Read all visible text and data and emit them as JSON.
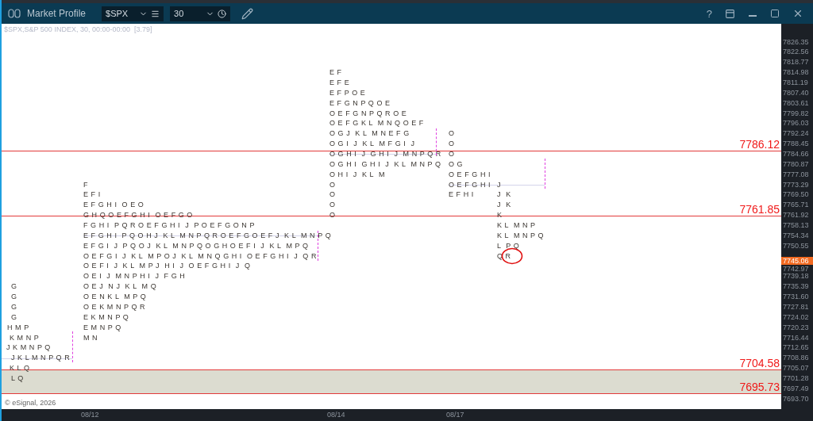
{
  "window": {
    "title": "Market Profile",
    "help": "?"
  },
  "toolbar": {
    "symbol": "$SPX",
    "interval": "30"
  },
  "chart": {
    "legend": "$SPX,S&P 500 INDEX, 30, 00:00-00:00  [3.79]",
    "copyright": "© eSignal, 2026",
    "profiles": [
      {
        "rows": [
          "G",
          "G",
          "G",
          "G",
          "H M P",
          "K M N P",
          "J K M N P Q",
          "J K L M N P Q R",
          "K L Q",
          "L Q"
        ]
      },
      {
        "rows": [
          "F",
          "E F I",
          "E F G H I  O E O",
          "G H Q O E F G H I  O E F G O",
          "F G H I  P Q R O E F G H I  J  P O E F G O N P",
          "E F G H I  P Q O H J  K L  M N P Q R O E F G O E F J  K L  M N P Q",
          "E F G I  J  P Q O J  K L  M N P Q O G H O E F I  J  K L  M P Q",
          "O E F G I  J  K L  M P O J  K L  M N Q G H I  O E F G H I  J  Q R",
          "O E F I  J  K L  M P J  H I  J  O E F G H I  J  Q",
          "O E I  J  M N P H I  J  F G H",
          "O E J  N J  K L  M Q",
          "O E N K L  M P Q",
          "O E K M N P Q R",
          "E K M N P Q",
          "E M N P Q",
          "M N"
        ]
      },
      {
        "rows": [
          "E F",
          "E F E",
          "E F P O E",
          "E F G N P Q O E",
          "O E F G N P Q R O E",
          "O E F G K L  M N Q O E F",
          "O G J  K L  M N E F G",
          "O G I  J  K L  M F G I  J",
          "O G H I  J  G H I  J  M N P Q R",
          "O G H I  G H I  J  K L  M N P Q",
          "O H I  J  K L  M",
          "O",
          "O",
          "O",
          "O"
        ]
      },
      {
        "rows": [
          "O",
          "O",
          "O",
          "O G",
          "O E F G H I",
          "O E F G H I",
          "E F H I"
        ]
      },
      {
        "rows": [
          "J",
          "J  K",
          "J  K",
          "K",
          "K L  M N P",
          "K L  M N P Q",
          "L  P Q",
          "Q R"
        ]
      }
    ],
    "levels": [
      {
        "label": "7786.12",
        "kind": "line"
      },
      {
        "label": "7761.85",
        "kind": "line"
      },
      {
        "label": "7704.58",
        "kind": "zone-top"
      },
      {
        "label": "7695.73",
        "kind": "zone-bottom"
      }
    ],
    "price_axis": [
      "7826.35",
      "7822.56",
      "7818.77",
      "7814.98",
      "7811.19",
      "7807.40",
      "7803.61",
      "7799.82",
      "7796.03",
      "7792.24",
      "7788.45",
      "7784.66",
      "7780.87",
      "7777.08",
      "7773.29",
      "7769.50",
      "7765.71",
      "7761.92",
      "7758.13",
      "7754.34",
      "7750.55",
      "7742.97",
      "7739.18",
      "7735.39",
      "7731.60",
      "7727.81",
      "7724.02",
      "7720.23",
      "7716.44",
      "7712.65",
      "7708.86",
      "7705.07",
      "7701.28",
      "7697.49",
      "7693.70"
    ],
    "current_price": "7745.06",
    "dates": [
      "08/12",
      "08/14",
      "08/17"
    ]
  }
}
